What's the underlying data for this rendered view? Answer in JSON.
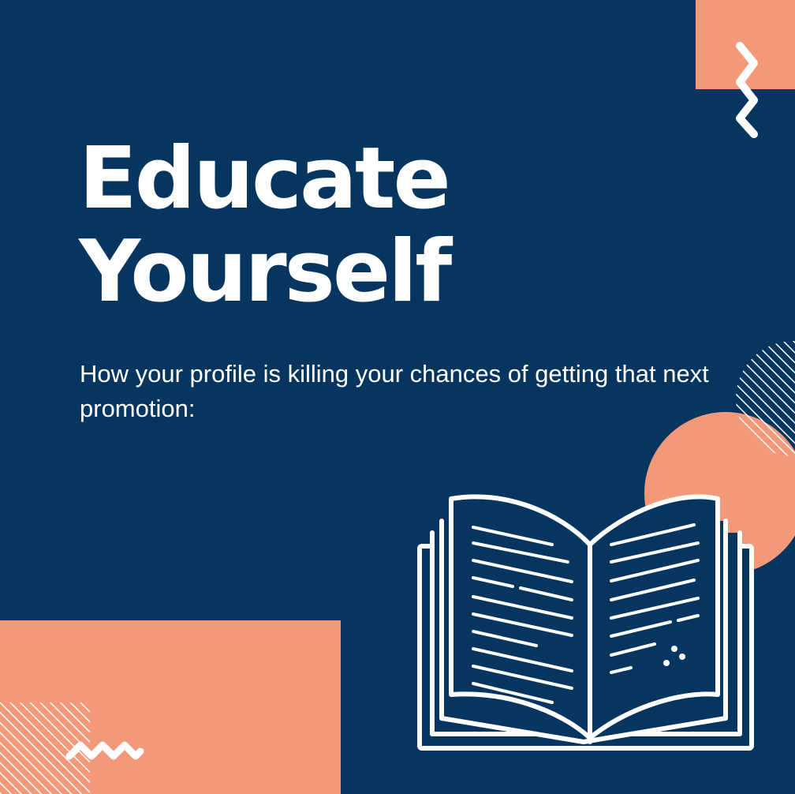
{
  "title": {
    "line1": "Educate",
    "line2": "Yourself"
  },
  "subtitle": "How your profile is killing your chances of getting that next promotion:",
  "colors": {
    "background": "#06365f",
    "accent": "#f4987a",
    "foreground": "#ffffff"
  },
  "icons": {
    "book": "open-book-icon",
    "zigzag": "zigzag-icon",
    "wave": "wave-icon"
  }
}
